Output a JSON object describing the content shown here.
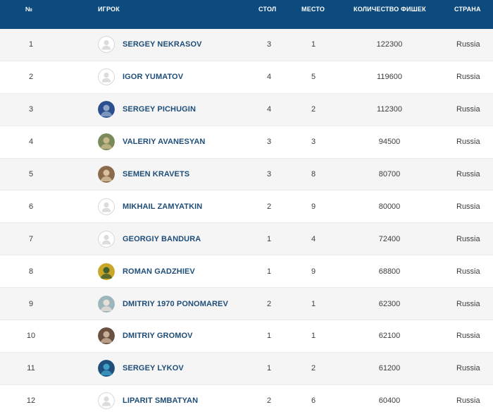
{
  "header": {
    "num": "№",
    "player": "ИГРОК",
    "table": "СТОЛ",
    "seat": "МЕСТО",
    "chips": "КОЛИЧЕСТВО ФИШЕК",
    "country": "СТРАНА"
  },
  "rows": [
    {
      "num": "1",
      "name": "SERGEY NEKRASOV",
      "table": "3",
      "seat": "1",
      "chips": "122300",
      "country": "Russia",
      "avatar": "placeholder-avatar-icon"
    },
    {
      "num": "2",
      "name": "IGOR YUMATOV",
      "table": "4",
      "seat": "5",
      "chips": "119600",
      "country": "Russia",
      "avatar": "placeholder-avatar-icon"
    },
    {
      "num": "3",
      "name": "SERGEY PICHUGIN",
      "table": "4",
      "seat": "2",
      "chips": "112300",
      "country": "Russia",
      "avatar": "player-photo-icon"
    },
    {
      "num": "4",
      "name": "VALERIY AVANESYAN",
      "table": "3",
      "seat": "3",
      "chips": "94500",
      "country": "Russia",
      "avatar": "player-photo-icon"
    },
    {
      "num": "5",
      "name": "SEMEN KRAVETS",
      "table": "3",
      "seat": "8",
      "chips": "80700",
      "country": "Russia",
      "avatar": "player-photo-icon"
    },
    {
      "num": "6",
      "name": "MIKHAIL ZAMYATKIN",
      "table": "2",
      "seat": "9",
      "chips": "80000",
      "country": "Russia",
      "avatar": "placeholder-avatar-icon"
    },
    {
      "num": "7",
      "name": "GEORGIY BANDURA",
      "table": "1",
      "seat": "4",
      "chips": "72400",
      "country": "Russia",
      "avatar": "placeholder-avatar-icon"
    },
    {
      "num": "8",
      "name": "ROMAN GADZHIEV",
      "table": "1",
      "seat": "9",
      "chips": "68800",
      "country": "Russia",
      "avatar": "player-photo-icon"
    },
    {
      "num": "9",
      "name": "DMITRIY 1970 PONOMAREV",
      "table": "2",
      "seat": "1",
      "chips": "62300",
      "country": "Russia",
      "avatar": "player-photo-icon"
    },
    {
      "num": "10",
      "name": "DMITRIY GROMOV",
      "table": "1",
      "seat": "1",
      "chips": "62100",
      "country": "Russia",
      "avatar": "player-photo-icon"
    },
    {
      "num": "11",
      "name": "SERGEY LYKOV",
      "table": "1",
      "seat": "2",
      "chips": "61200",
      "country": "Russia",
      "avatar": "player-photo-icon"
    },
    {
      "num": "12",
      "name": "LIPARIT SMBATYAN",
      "table": "2",
      "seat": "6",
      "chips": "60400",
      "country": "Russia",
      "avatar": "placeholder-avatar-icon"
    }
  ],
  "colors": {
    "header_bg": "#0d4b7e",
    "header_text": "#ffffff",
    "name_text": "#1e4d78",
    "row_odd_bg": "#f5f5f5",
    "row_even_bg": "#ffffff"
  }
}
